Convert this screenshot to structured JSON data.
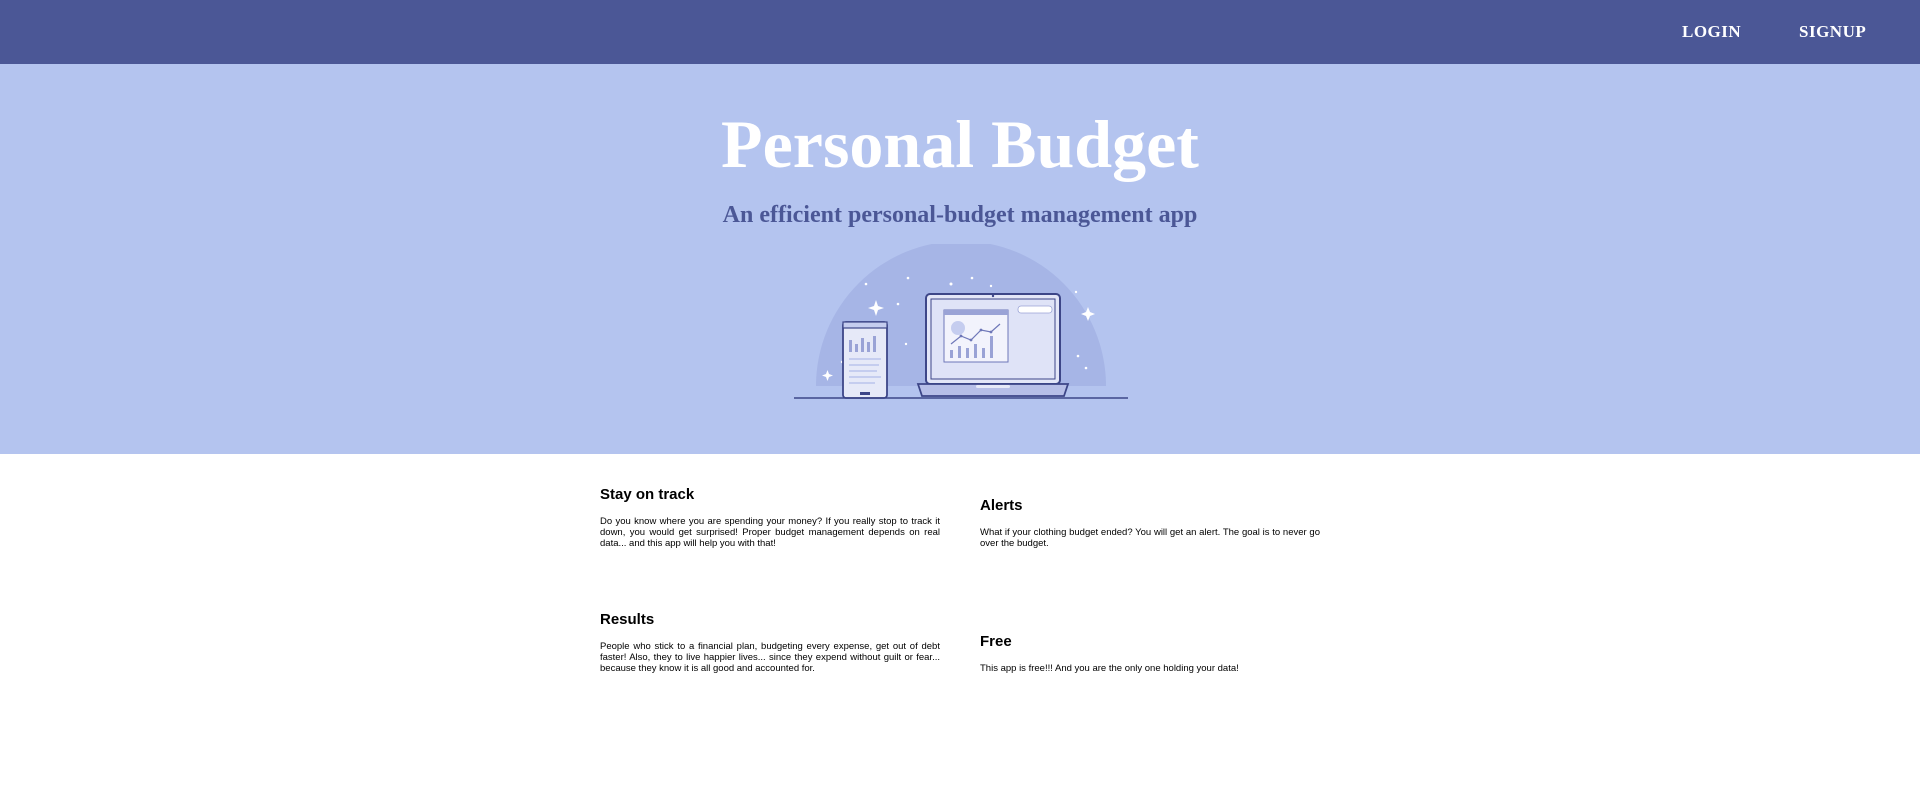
{
  "nav": {
    "login_label": "LOGIN",
    "signup_label": "SIGNUP"
  },
  "hero": {
    "title": "Personal Budget",
    "subtitle": "An efficient personal-budget management app",
    "illustration": "phone-and-laptop-chart-illustration"
  },
  "features": [
    {
      "title": "Stay on track",
      "text": "Do you know where you are spending your money? If you really stop to track it down, you would get surprised! Proper budget management depends on real data... and this app will help you with that!"
    },
    {
      "title": "Alerts",
      "text": "What if your clothing budget ended? You will get an alert. The goal is to never go over the budget."
    },
    {
      "title": "Results",
      "text": "People who stick to a financial plan, budgeting every expense, get out of debt faster! Also, they to live happier lives... since they expend without guilt or fear... because they know it is all good and accounted for."
    },
    {
      "title": "Free",
      "text": "This app is free!!! And you are the only one holding your data!"
    }
  ],
  "colors": {
    "nav_bg": "#4b5796",
    "hero_bg": "#b4c4ef",
    "accent": "#4b5796",
    "title": "#ffffff"
  }
}
